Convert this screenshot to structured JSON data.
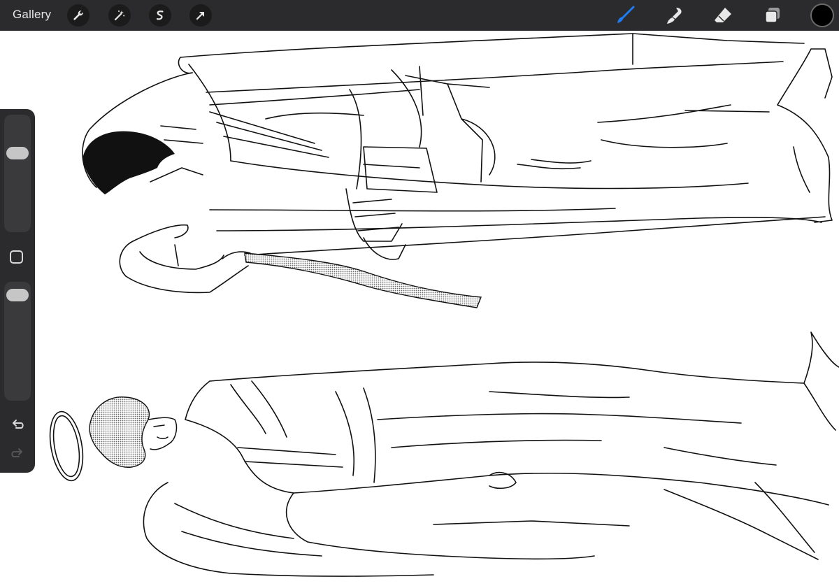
{
  "app": {
    "gallery_label": "Gallery",
    "accent_color": "#1e7cf2",
    "current_color": "#000000"
  },
  "toolbar_left": [
    {
      "name": "actions-wrench-icon"
    },
    {
      "name": "adjustments-magic-wand-icon"
    },
    {
      "name": "selection-icon"
    },
    {
      "name": "transform-arrow-icon"
    }
  ],
  "toolbar_right": [
    {
      "name": "brush-icon",
      "active": true
    },
    {
      "name": "smudge-icon",
      "active": false
    },
    {
      "name": "eraser-icon",
      "active": false
    },
    {
      "name": "layers-icon",
      "active": false
    }
  ],
  "sidebar": {
    "brush_size_level": 0.7,
    "opacity_level": 0.95,
    "modifier_icon": "square-icon",
    "undo_icon": "undo-icon",
    "redo_icon": "redo-icon"
  },
  "canvas": {
    "content": "sketch-figures"
  }
}
